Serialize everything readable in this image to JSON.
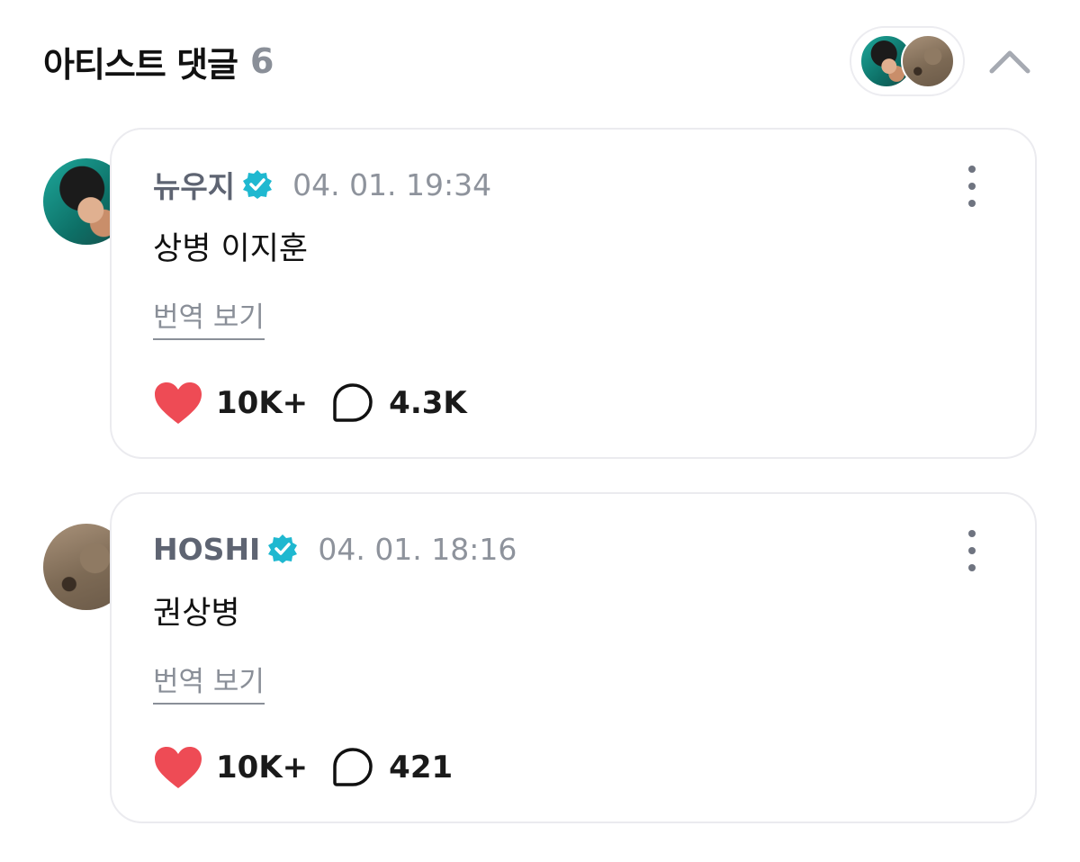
{
  "header": {
    "title": "아티스트 댓글",
    "count": "6"
  },
  "colors": {
    "verified": "#1fb8d0",
    "like": "#ee4b55",
    "muted": "#8a8f98",
    "author": "#5e6472"
  },
  "comments": [
    {
      "author": "뉴우지",
      "timestamp": "04. 01. 19:34",
      "text": "상병 이지훈",
      "translate_label": "번역 보기",
      "likes": "10K+",
      "replies": "4.3K"
    },
    {
      "author": "HOSHI",
      "timestamp": "04. 01. 18:16",
      "text": "권상병",
      "translate_label": "번역 보기",
      "likes": "10K+",
      "replies": "421"
    }
  ]
}
